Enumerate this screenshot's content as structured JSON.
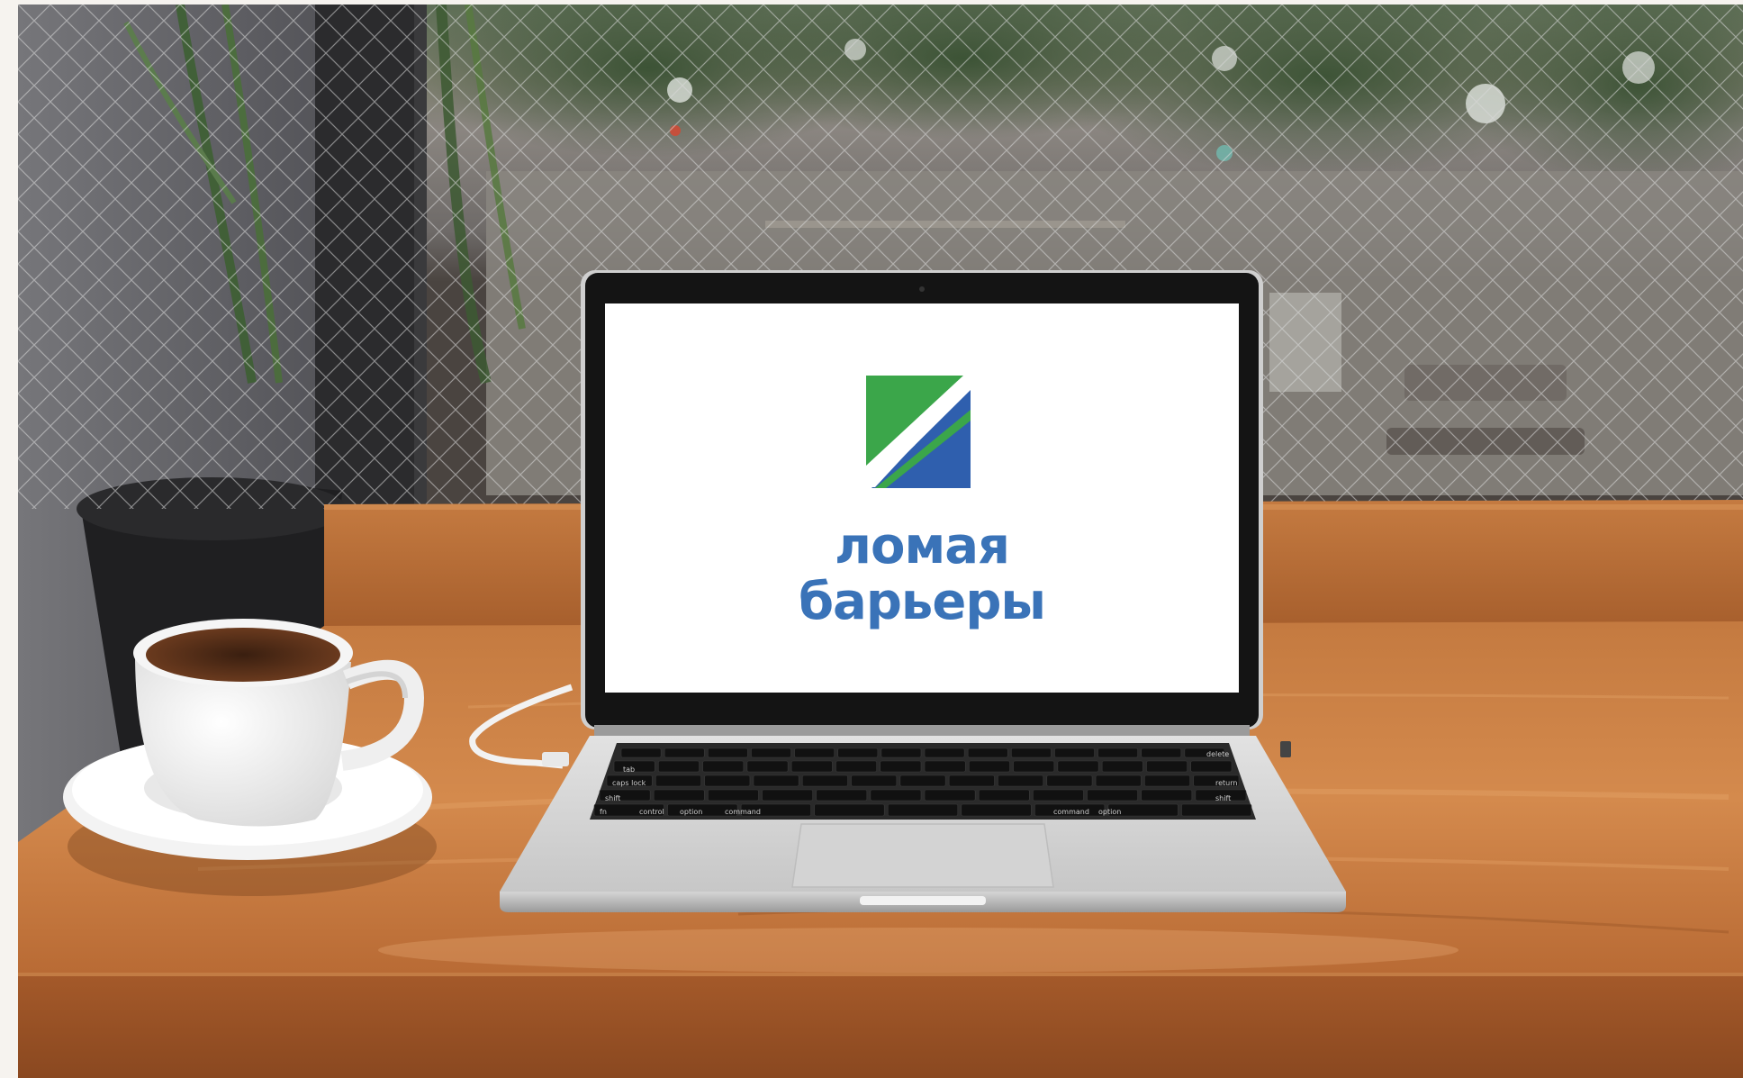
{
  "photo": {
    "subject": "laptop on cafe table with coffee cup",
    "colors": {
      "background_margin": "#f6f3ef",
      "table_wood": "#c8773e",
      "laptop_body": "#dcdcdc",
      "screen_bezel": "#141414",
      "screen": "#ffffff"
    }
  },
  "screen": {
    "logo": {
      "line1": "ломая",
      "line2": "барьеры",
      "colors": {
        "green": "#3ba64a",
        "blue": "#2f5fae",
        "text": "#3a73b8"
      }
    }
  },
  "keyboard": {
    "labels": [
      "tab",
      "caps lock",
      "shift",
      "fn",
      "control",
      "option",
      "command",
      "command",
      "option",
      "delete",
      "return",
      "shift"
    ]
  }
}
